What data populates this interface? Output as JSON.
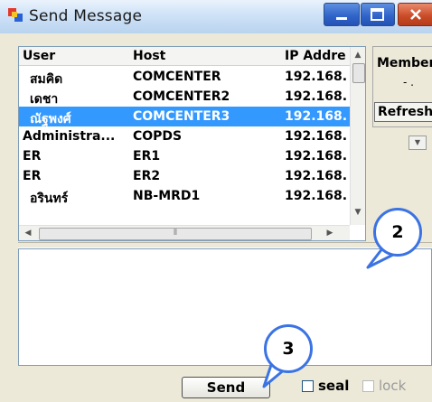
{
  "window": {
    "title": "Send Message"
  },
  "grid": {
    "columns": [
      "User",
      "Host",
      "IP Addre"
    ],
    "rows": [
      {
        "user": "สมคิด",
        "host": "COMCENTER",
        "ip": "192.168."
      },
      {
        "user": "เดชา",
        "host": "COMCENTER2",
        "ip": "192.168."
      },
      {
        "user": "ณัฐพงศ์",
        "host": "COMCENTER3",
        "ip": "192.168."
      },
      {
        "user": "Administra...",
        "host": "COPDS",
        "ip": "192.168."
      },
      {
        "user": "ER",
        "host": "ER1",
        "ip": "192.168."
      },
      {
        "user": "ER",
        "host": "ER2",
        "ip": "192.168."
      },
      {
        "user": "อรินทร์",
        "host": "NB-MRD1",
        "ip": "192.168."
      }
    ],
    "selected_row": 2
  },
  "side": {
    "member_label": "Member",
    "member_value": "- .",
    "refresh_label": "Refresh"
  },
  "footer": {
    "send_label": "Send",
    "seal_label": "seal",
    "lock_label": "lock"
  },
  "callouts": {
    "c2": "2",
    "c3": "3"
  },
  "colors": {
    "selection": "#3399ff",
    "callout_border": "#3b73e4"
  }
}
